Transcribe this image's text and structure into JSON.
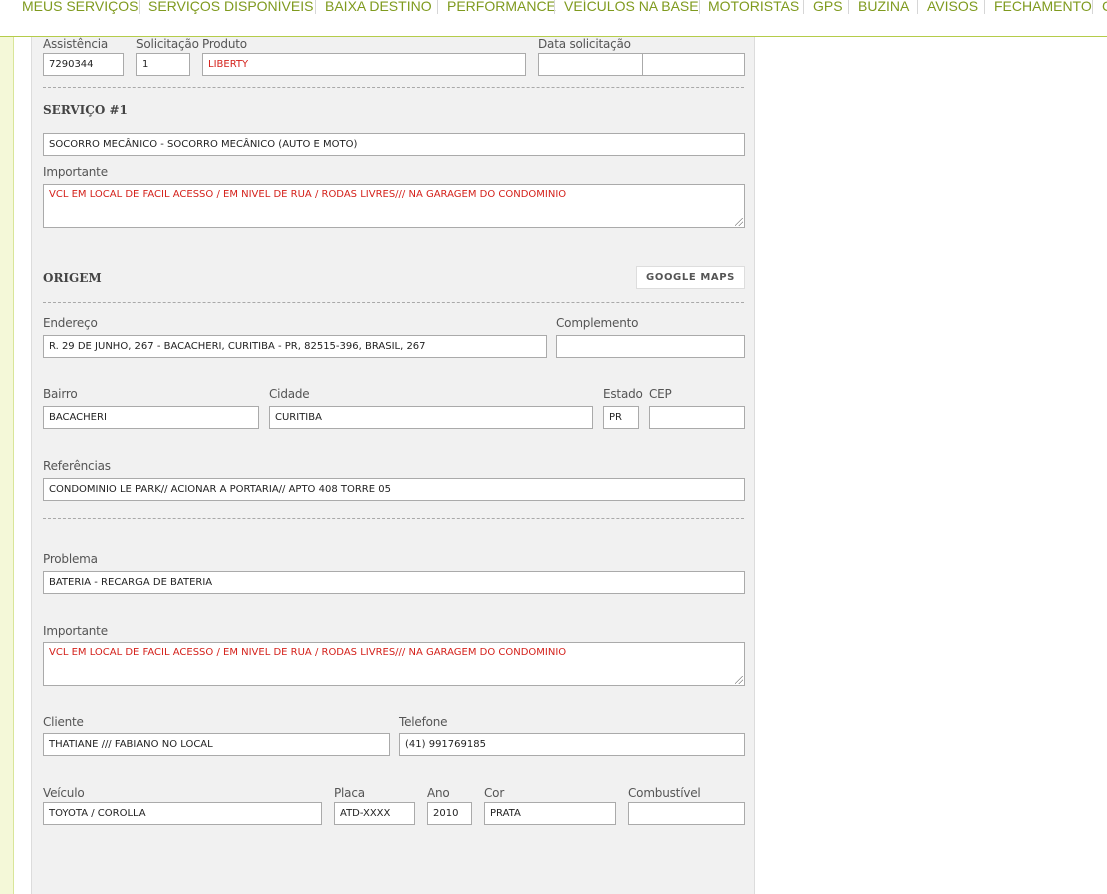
{
  "nav": {
    "items": [
      "MEUS SERVIÇOS",
      "SERVIÇOS DISPONÍVEIS",
      "BAIXA DESTINO",
      "PERFORMANCE",
      "VEÍCULOS NA BASE",
      "MOTORISTAS",
      "GPS",
      "BUZINA",
      "AVISOS",
      "FECHAMENTO",
      "C"
    ],
    "color": "#7f9a1e"
  },
  "header_row": {
    "assistencia_label": "Assistência",
    "assistencia_value": "7290344",
    "solicitacao_label": "Solicitação",
    "solicitacao_value": "1",
    "produto_label": "Produto",
    "produto_value": "LIBERTY",
    "data_label": "Data solicitação",
    "data_value_1": "",
    "data_value_2": ""
  },
  "service": {
    "title": "SERVIÇO #1",
    "value": "SOCORRO MECÂNICO - SOCORRO MECÂNICO (AUTO E MOTO)",
    "importante_label": "Importante",
    "importante_value": "VCL EM LOCAL DE FACIL ACESSO / EM NIVEL DE RUA / RODAS LIVRES/// NA GARAGEM DO CONDOMINIO"
  },
  "origem": {
    "title": "ORIGEM",
    "maps_button": "GOOGLE MAPS",
    "endereco_label": "Endereço",
    "endereco_value": "R. 29 DE JUNHO, 267 - BACACHERI, CURITIBA - PR, 82515-396, BRASIL, 267",
    "complemento_label": "Complemento",
    "complemento_value": "",
    "bairro_label": "Bairro",
    "bairro_value": "BACACHERI",
    "cidade_label": "Cidade",
    "cidade_value": "CURITIBA",
    "estado_label": "Estado",
    "estado_value": "PR",
    "cep_label": "CEP",
    "cep_value": "",
    "referencias_label": "Referências",
    "referencias_value": "CONDOMINIO LE PARK// ACIONAR A PORTARIA// APTO 408 TORRE 05"
  },
  "problema": {
    "label": "Problema",
    "value": "BATERIA - RECARGA DE BATERIA",
    "importante_label": "Importante",
    "importante_value": "VCL EM LOCAL DE FACIL ACESSO / EM NIVEL DE RUA / RODAS LIVRES/// NA GARAGEM DO CONDOMINIO"
  },
  "cliente": {
    "cliente_label": "Cliente",
    "cliente_value": "THATIANE /// FABIANO NO LOCAL",
    "telefone_label": "Telefone",
    "telefone_value": "(41) 991769185"
  },
  "veiculo": {
    "veiculo_label": "Veículo",
    "veiculo_value": "TOYOTA / COROLLA",
    "placa_label": "Placa",
    "placa_value": "ATD-XXXX",
    "ano_label": "Ano",
    "ano_value": "2010",
    "cor_label": "Cor",
    "cor_value": "PRATA",
    "combustivel_label": "Combustível",
    "combustivel_value": ""
  },
  "colors": {
    "accent": "#7f9a1e",
    "alert_text": "#d4211b",
    "panel_bg": "#f1f1f1"
  }
}
